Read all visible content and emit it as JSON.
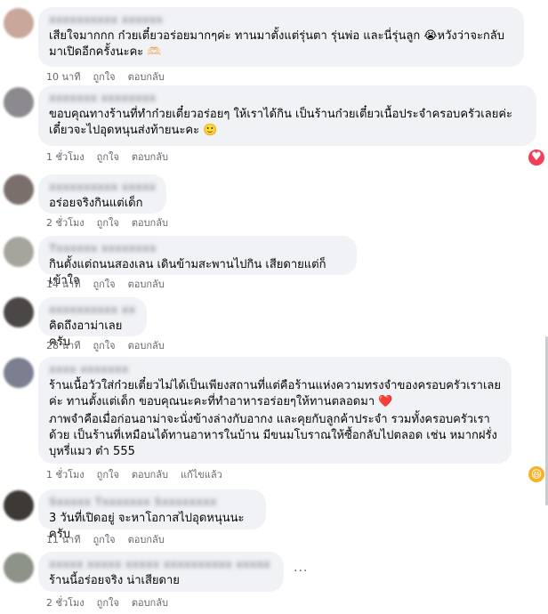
{
  "labels": {
    "like": "ถูกใจ",
    "reply": "ตอบกลับ",
    "edited": "แก้ไขแล้ว"
  },
  "comments": [
    {
      "name": "xxxxxxxxxx xxxxxx",
      "text": "เสียใจมากกก ก๋วยเตี๋ยวอร่อยมากๆค่ะ ทานมาตั้งแต่รุ่นตา รุ่นพ่อ และนี่รุ่นลูก 😭หวังว่าจะกลับมาเปิดอีกครั้งนะคะ 🫶🏻",
      "time": "10 นาที"
    },
    {
      "name": "xxxxxxx xxxxxxxx",
      "text": "ขอบคุณทางร้านที่ทำก๋วยเตี๋ยวอร่อยๆ ให้เราได้กิน เป็นร้านก๋วยเตี๋ยวเนื้อประจำครอบครัวเลยค่ะ เดี๋ยวจะไปอุดหนุนส่งท้ายนะคะ 🙂",
      "time": "1 ชั่วโมง"
    },
    {
      "name": "xxxxxxxxxx xxxxxxxxx",
      "text": "อร่อยจริงกินแต่เด็ก",
      "time": "2 ชั่วโมง"
    },
    {
      "name": "Txxxxxx xxxxxxxx",
      "text": "กินตั้งแต่ถนนสองเลน เดินข้ามสะพานไปกิน เสียดายแต่ก็เข้าใจ",
      "time": "14 นาที"
    },
    {
      "name": "xxxxxxxxxx xxxx",
      "text": "คิดถึงอาม่าเลยครับ",
      "time": "28 นาที"
    },
    {
      "name": "xxxx xxxxxxx",
      "text1": "ร้านเนื้อวัวใส่ก๋วยเตี๋ยวไม่ได้เป็นเพียงสถานที่แต่คือร้านแห่งความทรงจำของครอบครัวเราเลยค่ะ ทานตั้งแต่เด็ก ขอบคุณนะคะที่ทำอาหารอร่อยๆให้ทานตลอดมา ❤️",
      "text2": "ภาพจำคือเมื่อก่อนอาม่าจะนั่งข้างล่างกับอากง และคุยกับลูกค้าประจำ รวมทั้งครอบครัวเราด้วย เป็นร้านที่เหมือนได้ทานอาหารในบ้าน มีขนมโบราณให้ซื้อกลับไปตลอด เช่น หมากฝรั่งบุหรี่แมว ต๋า 555",
      "time": "1 ชั่วโมง"
    },
    {
      "name": "Sxxxxx Txxxxxxx Sxxxxxxxx",
      "text": "3 วันที่เปิดอยู่ จะหาโอกาสไปอุดหนุนนะครับ",
      "time": "11 นาที"
    },
    {
      "name": "xxxxx xxxxx xxxxx xxxxxxxxxx xxxxx",
      "text": "ร้านนี้อร่อยจริง น่าเสียดาย",
      "time": "2 ชั่วโมง"
    }
  ],
  "colors": {
    "love": "#f33e58",
    "haha": "#f7b125"
  },
  "icons": {
    "love": "heart-reaction-icon",
    "haha": "haha-reaction-icon",
    "more": "more-options-icon"
  },
  "glyphs": {
    "heart": "♥",
    "haha": "😆",
    "more": "···"
  }
}
